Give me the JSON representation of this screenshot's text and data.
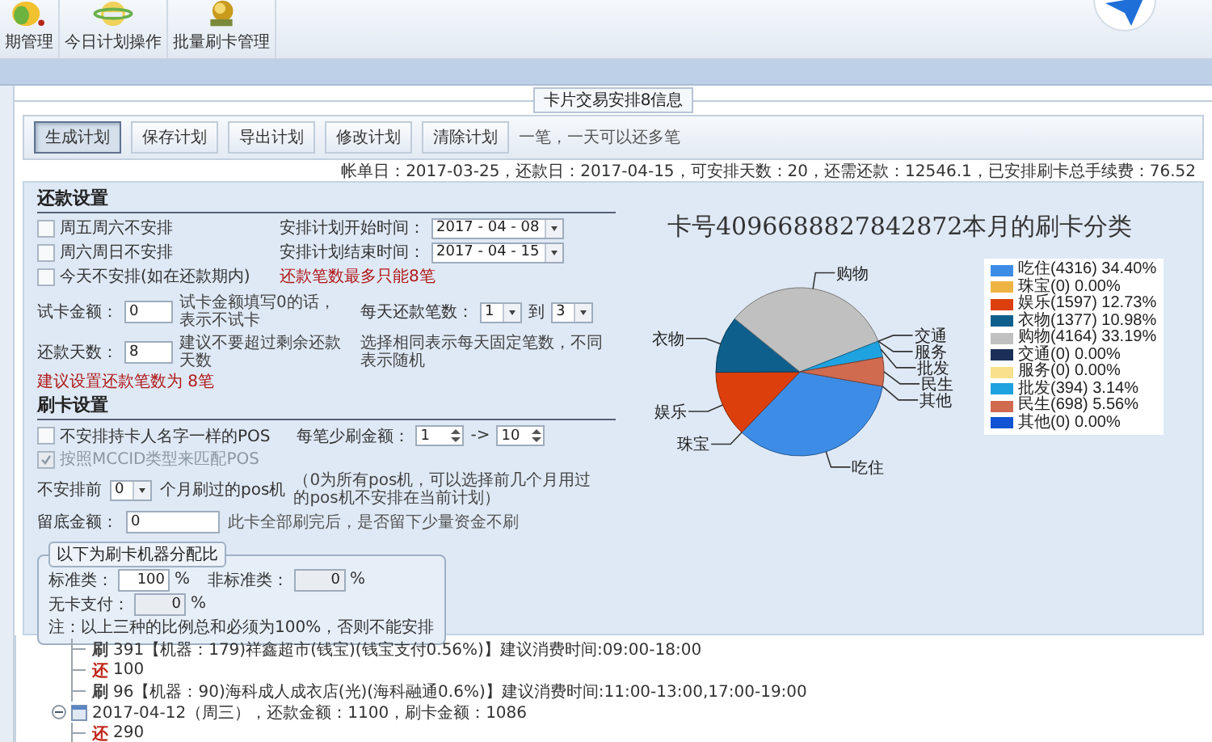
{
  "toolbar": {
    "items": [
      {
        "label": "期管理",
        "kind": "fruit"
      },
      {
        "label": "今日计划操作",
        "kind": "globe"
      },
      {
        "label": "批量刷卡管理",
        "kind": "coins"
      }
    ]
  },
  "section_title": "卡片交易安排8信息",
  "buttons": [
    {
      "label": "生成计划",
      "selected": true
    },
    {
      "label": "保存计划",
      "selected": false
    },
    {
      "label": "导出计划",
      "selected": false
    },
    {
      "label": "修改计划",
      "selected": false
    },
    {
      "label": "清除计划",
      "selected": false
    }
  ],
  "button_hint": "一笔，一天可以还多笔",
  "summary": "帐单日：2017-03-25，还款日：2017-04-15，可安排天数：20，还需还款：12546.1，已安排刷卡总手续费：76.52",
  "repayment": {
    "title": "还款设置",
    "options": [
      {
        "label": "周五周六不安排",
        "checked": false
      },
      {
        "label": "周六周日不安排",
        "checked": false
      },
      {
        "label": "今天不安排(如在还款期内)",
        "checked": false
      }
    ],
    "start": {
      "label": "安排计划开始时间：",
      "value": "2017 - 04 - 08"
    },
    "end": {
      "label": "安排计划结束时间：",
      "value": "2017 - 04 - 15"
    },
    "warning": "还款笔数最多只能8笔",
    "test_amount": {
      "label": "试卡金额：",
      "value": "0",
      "hint": "试卡金额填写0的话，表示不试卡"
    },
    "daily_count": {
      "label": "每天还款笔数：",
      "from": "1",
      "to_label": "到",
      "to": "3",
      "hint": "选择相同表示每天固定笔数，不同表示随机"
    },
    "days": {
      "label": "还款天数：",
      "value": "8",
      "hint": "建议不要超过剩余还款天数"
    },
    "advice": "建议设置还款笔数为 8笔"
  },
  "swipe": {
    "title": "刷卡设置",
    "same_name": {
      "label": "不安排持卡人名字一样的POS",
      "checked": false
    },
    "min_amount": {
      "label": "每笔少刷金额：",
      "from": "1",
      "arrow": "->",
      "to": "10"
    },
    "mcc": {
      "label": "按照MCCID类型来匹配POS",
      "checked": true,
      "disabled": true
    },
    "exclude": {
      "label": "不安排前",
      "value": "0",
      "unit": "个月刷过的pos机",
      "hint": "（0为所有pos机，可以选择前几个月用过的pos机不安排在当前计划）"
    },
    "reserve": {
      "label": "留底金额：",
      "value": "0",
      "hint": "此卡全部刷完后，是否留下少量资金不刷"
    },
    "ratio": {
      "title": "以下为刷卡机器分配比",
      "fields": [
        {
          "label": "标准类：",
          "value": "100",
          "unit": "%",
          "disabled": false
        },
        {
          "label": "非标准类：",
          "value": "0",
          "unit": "%",
          "disabled": true
        },
        {
          "label": "无卡支付：",
          "value": "0",
          "unit": "%",
          "disabled": true
        }
      ],
      "note": "注：以上三种的比例总和必须为100%，否则不能安排"
    }
  },
  "chart": {
    "legend": [
      {
        "label": "吃住(4316) 34.40%",
        "color": "#3d8de6"
      },
      {
        "label": "珠宝(0) 0.00%",
        "color": "#eeb443"
      },
      {
        "label": "娱乐(1597) 12.73%",
        "color": "#dd3f0c"
      },
      {
        "label": "衣物(1377) 10.98%",
        "color": "#0f5f8c"
      },
      {
        "label": "购物(4164) 33.19%",
        "color": "#c0c0c0"
      },
      {
        "label": "交通(0) 0.00%",
        "color": "#1b3058"
      },
      {
        "label": "服务(0) 0.00%",
        "color": "#f8e08c"
      },
      {
        "label": "批发(394) 3.14%",
        "color": "#1ea2e0"
      },
      {
        "label": "民生(698) 5.56%",
        "color": "#d06b50"
      },
      {
        "label": "其他(0) 0.00%",
        "color": "#1153d2"
      }
    ],
    "chart_data": {
      "type": "pie",
      "title": "卡号4096688827842872本月的刷卡分类",
      "categories": [
        "吃住",
        "珠宝",
        "娱乐",
        "衣物",
        "购物",
        "交通",
        "服务",
        "批发",
        "民生",
        "其他"
      ],
      "series": [
        {
          "values": [
            34.4,
            0,
            12.73,
            10.98,
            33.19,
            0,
            0,
            3.14,
            5.56,
            0
          ]
        }
      ]
    }
  },
  "tree": {
    "continued_rows": [
      {
        "kind": "swipe",
        "tag": "刷",
        "text": "391【机器：179)祥鑫超市(钱宝)(钱宝支付0.56%)】建议消费时间:09:00-18:00"
      },
      {
        "kind": "repay",
        "tag": "还",
        "text": "100"
      },
      {
        "kind": "swipe",
        "tag": "刷",
        "text": "96【机器：90)海科成人成衣店(光)(海科融通0.6%)】建议消费时间:11:00-13:00,17:00-19:00"
      }
    ],
    "days": [
      {
        "text": "2017-04-12（周三），还款金额：1100，刷卡金额：1086",
        "expanded": true,
        "children": [
          {
            "kind": "repay",
            "tag": "还",
            "text": "290"
          }
        ]
      }
    ]
  }
}
